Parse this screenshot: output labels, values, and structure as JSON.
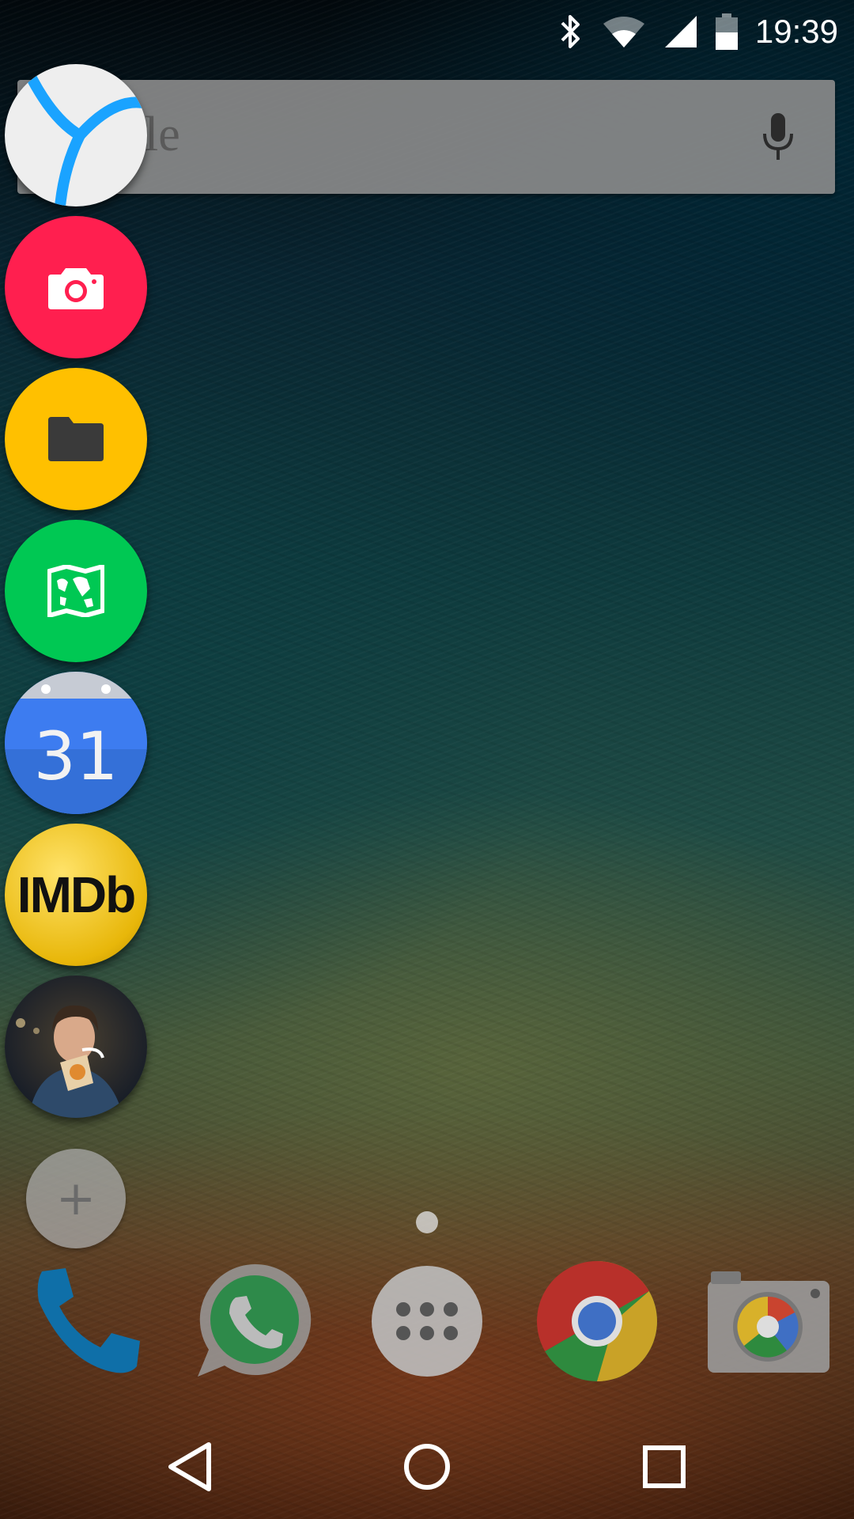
{
  "status_bar": {
    "time": "19:39",
    "icons": [
      "bluetooth-icon",
      "wifi-icon",
      "cell-signal-icon",
      "battery-icon"
    ]
  },
  "search_bar": {
    "logo_text": "gle",
    "icons": [
      "mic-icon"
    ]
  },
  "floating_bubbles": [
    {
      "name": "yandex-browser",
      "icon": "yandex-browser-icon",
      "color": "#eeeeee"
    },
    {
      "name": "camera",
      "icon": "camera-icon",
      "color": "#ff1f4f"
    },
    {
      "name": "files",
      "icon": "folder-icon",
      "color": "#ffc000"
    },
    {
      "name": "maps",
      "icon": "map-icon",
      "color": "#00c853"
    },
    {
      "name": "calendar",
      "icon": "calendar-icon",
      "label": "31",
      "color": "#3d7cf0"
    },
    {
      "name": "imdb",
      "icon": "imdb-icon",
      "label": "IMDb",
      "color": "#f5c518"
    },
    {
      "name": "contact",
      "icon": "contact-photo-icon"
    }
  ],
  "add_bubble": {
    "label": "+"
  },
  "dock": [
    {
      "name": "phone",
      "icon": "phone-icon"
    },
    {
      "name": "whatsapp",
      "icon": "whatsapp-icon"
    },
    {
      "name": "app-drawer",
      "icon": "app-drawer-icon"
    },
    {
      "name": "chrome",
      "icon": "chrome-icon"
    },
    {
      "name": "camera",
      "icon": "camera-app-icon"
    }
  ],
  "nav_bar": {
    "icons": [
      "back-icon",
      "home-icon",
      "recents-icon"
    ]
  },
  "colors": {
    "accent_red": "#ff1f4f",
    "accent_yellow": "#ffc000",
    "accent_green": "#00c853",
    "calendar_blue": "#3d7cf0"
  }
}
